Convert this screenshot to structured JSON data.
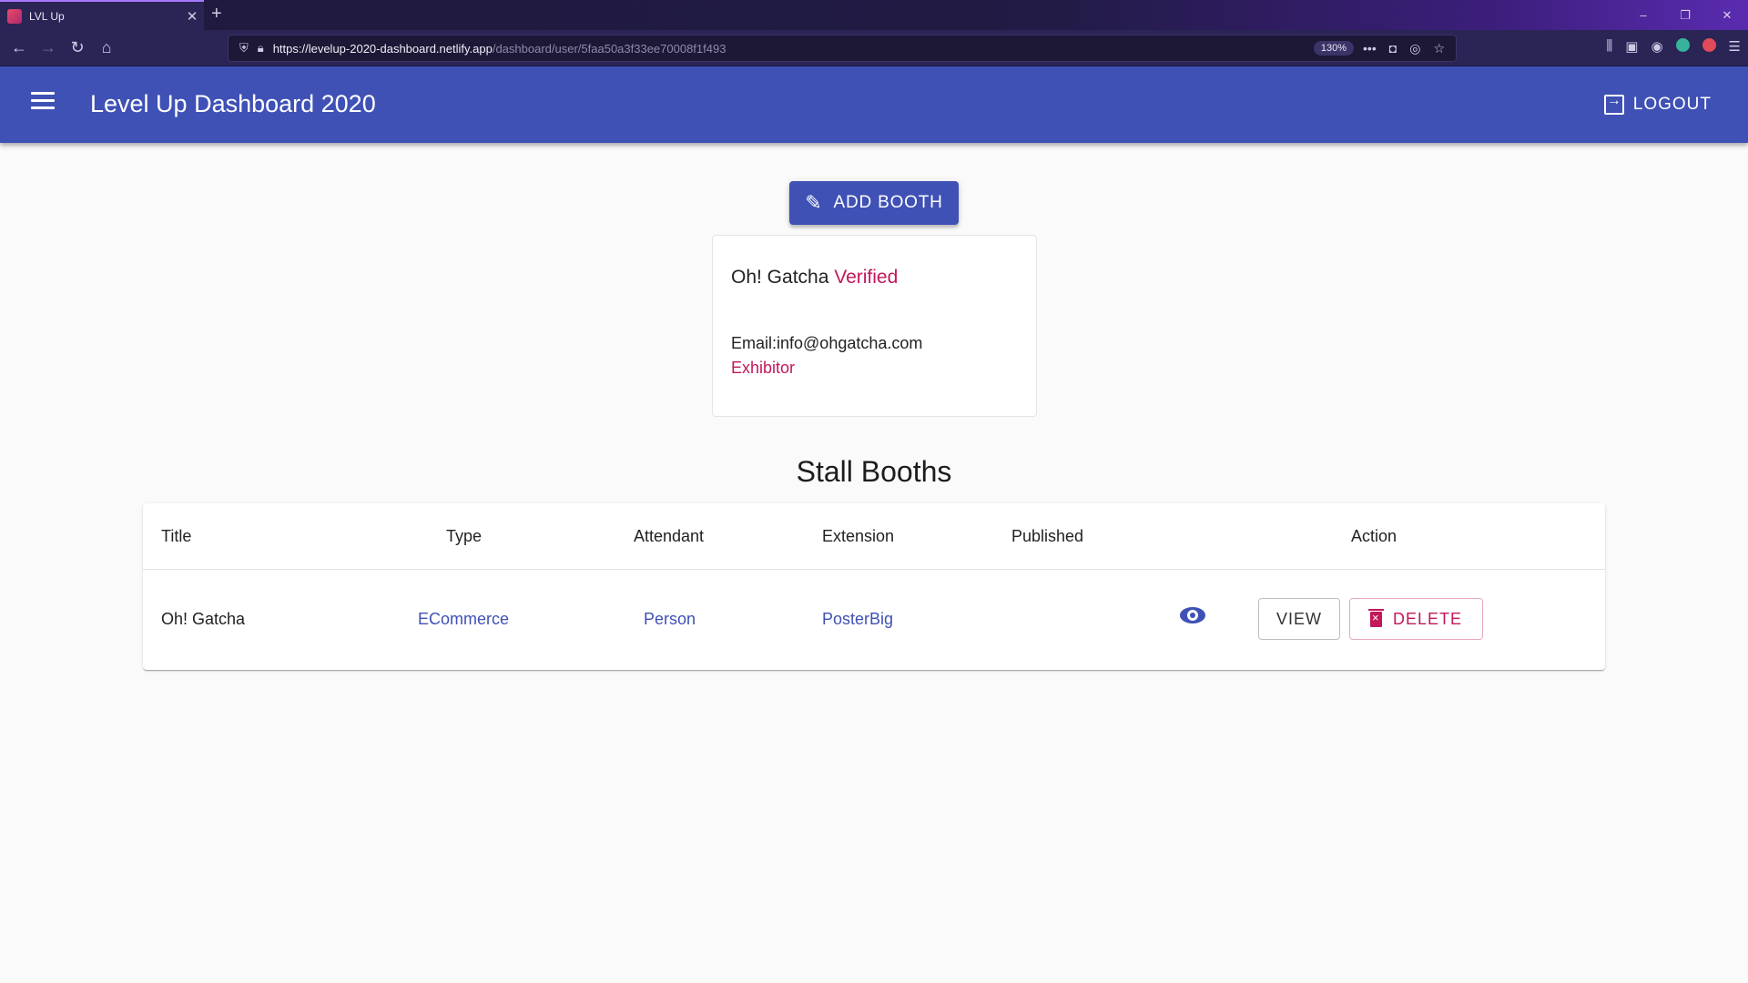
{
  "browser": {
    "tab_title": "LVL Up",
    "tab_close": "✕",
    "new_tab": "+",
    "url_host": "https://levelup-2020-dashboard.netlify.app",
    "url_path": "/dashboard/user/5faa50a3f33ee70008f1f493",
    "zoom": "130%",
    "window_controls": [
      "–",
      "❐",
      "✕"
    ]
  },
  "appbar": {
    "title": "Level Up Dashboard 2020",
    "logout_label": "LOGOUT"
  },
  "add_booth_label": "ADD BOOTH",
  "profile": {
    "name": "Oh! Gatcha",
    "status": "Verified",
    "email": "Email:info@ohgatcha.com",
    "role": "Exhibitor"
  },
  "section_title": "Stall Booths",
  "table": {
    "headers": [
      "Title",
      "Type",
      "Attendant",
      "Extension",
      "Published",
      "Action"
    ],
    "rows": [
      {
        "title": "Oh! Gatcha",
        "type": "ECommerce",
        "attendant": "Person",
        "extension": "PosterBig",
        "published_icon": "eye-icon",
        "view_label": "VIEW",
        "delete_label": "DELETE"
      }
    ]
  },
  "colors": {
    "primary": "#3f51b5",
    "accent": "#c2185b",
    "background": "#fafafa"
  }
}
